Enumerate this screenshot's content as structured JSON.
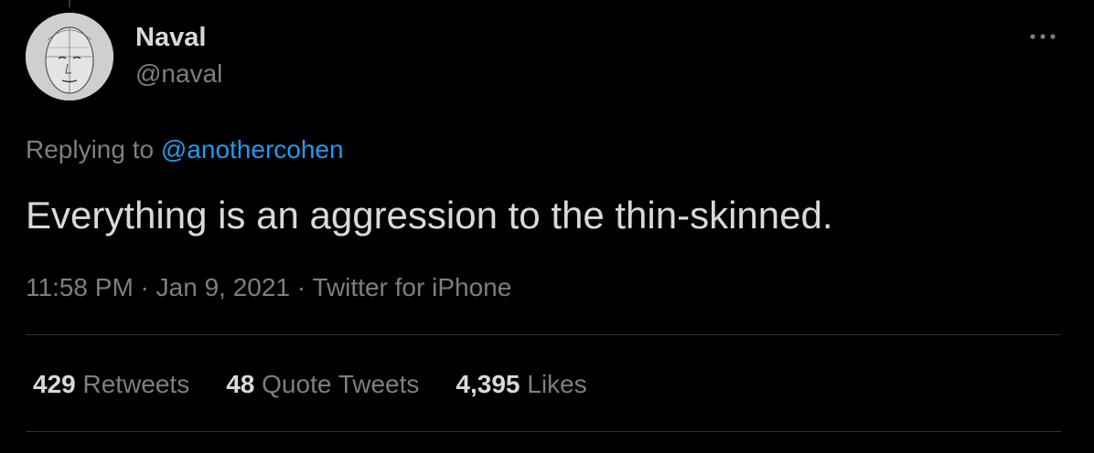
{
  "author": {
    "display_name": "Naval",
    "handle": "@naval"
  },
  "reply": {
    "prefix": "Replying to ",
    "mention": "@anothercohen"
  },
  "tweet": {
    "text": "Everything is an aggression to the thin-skinned."
  },
  "meta": {
    "time": "11:58 PM",
    "separator": " · ",
    "date": "Jan 9, 2021",
    "source": "Twitter for iPhone"
  },
  "stats": {
    "retweets_count": "429",
    "retweets_label": " Retweets",
    "quotes_count": "48",
    "quotes_label": " Quote Tweets",
    "likes_count": "4,395",
    "likes_label": " Likes"
  },
  "icons": {
    "more": "more-horizontal-icon",
    "avatar": "avatar-sketch-face"
  },
  "colors": {
    "background": "#000000",
    "text": "#d9d9d9",
    "secondary": "#7a7f84",
    "accent": "#1d9bf0",
    "divider": "#2f3336"
  }
}
